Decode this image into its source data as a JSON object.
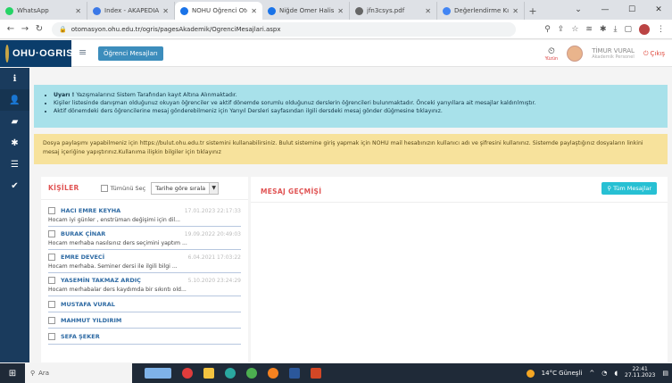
{
  "browser": {
    "tabs": [
      {
        "title": "WhatsApp",
        "color": "#25D366",
        "active": false
      },
      {
        "title": "Index - AKAPEDIA | A",
        "color": "#3b78e7",
        "active": false
      },
      {
        "title": "NOHU Öğrenci Otom",
        "color": "#1a73e8",
        "active": true
      },
      {
        "title": "Niğde Ömer Halisde",
        "color": "#1a73e8",
        "active": false
      },
      {
        "title": "jfn3csys.pdf",
        "color": "#666666",
        "active": false
      },
      {
        "title": "Değerlendirme Kılavu",
        "color": "#4285f4",
        "active": false
      }
    ],
    "new_tab": "+",
    "url": "otomasyon.ohu.edu.tr/ogris/pagesAkademik/OgrenciMesajlari.aspx"
  },
  "header": {
    "logo_text": "OHU·OGRIS",
    "page_tag": "Öğrenci Mesajları",
    "clock_label": "Yüzün",
    "user_name": "TİMUR VURAL",
    "user_role": "Akademik Personel",
    "logout": "Çıkış"
  },
  "info_alert": {
    "items": [
      {
        "bold": "Uyarı !",
        "text": "Yazışmalarınız Sistem Tarafından kayıt Altına Alınmaktadır."
      },
      {
        "bold": "",
        "text": "Kişiler listesinde danışman olduğunuz okuyan öğrenciler ve aktif dönemde sorumlu olduğunuz derslerin öğrencileri bulunmaktadır. Önceki yarıyıllara ait mesajlar kaldırılmıştır."
      },
      {
        "bold": "",
        "text": "Aktif dönemdeki ders öğrencilerine mesaj gönderebilmeniz için Yarıyıl Dersleri sayfasından ilgili dersdeki mesaj gönder düğmesine tıklayınız."
      }
    ]
  },
  "warn_alert": {
    "text": "Dosya paylaşımı yapabilmeniz için https://bulut.ohu.edu.tr sistemini kullanabilirsiniz. Bulut sistemine giriş yapmak için NOHU mail hesabınızın kullanıcı adı ve şifresini kullanınız. Sistemde paylaştığınız dosyaların linkini mesaj içeriğine yapıştırınız.Kullanıma ilişkin bilgiler için tıklayınız"
  },
  "contacts": {
    "title": "KİŞİLER",
    "select_all": "Tümünü Seç",
    "sort_label": "Tarihe göre sırala",
    "people": [
      {
        "name": "HACI EMRE KEYHA",
        "date": "17.01.2023 22:17:33",
        "message": "Hocam iyi günler , enstrüman değişimi için dil..."
      },
      {
        "name": "BURAK ÇİNAR",
        "date": "19.09.2022 20:49:03",
        "message": "Hocam merhaba nasılsınız ders seçimini yaptım ..."
      },
      {
        "name": "EMRE DEVECİ",
        "date": "6.04.2021 17:03:22",
        "message": "Hocam merhaba. Seminer dersi ile ilgili bilgi ..."
      },
      {
        "name": "YASEMİN TAKMAZ ARDIÇ",
        "date": "5.10.2020 23:24:29",
        "message": "Hocam merhabalar ders kaydımda bir sıkıntı old..."
      },
      {
        "name": "MUSTAFA VURAL",
        "date": "",
        "message": ""
      },
      {
        "name": "MAHMUT YILDIRIM",
        "date": "",
        "message": ""
      },
      {
        "name": "SEFA ŞEKER",
        "date": "",
        "message": ""
      }
    ]
  },
  "messages": {
    "title": "MESAJ GEÇMİŞİ",
    "all_button": "Tüm Mesajlar"
  },
  "taskbar": {
    "search": "Ara",
    "weather": "14°C Güneşli",
    "time": "22:41",
    "date": "27.11.2023"
  }
}
